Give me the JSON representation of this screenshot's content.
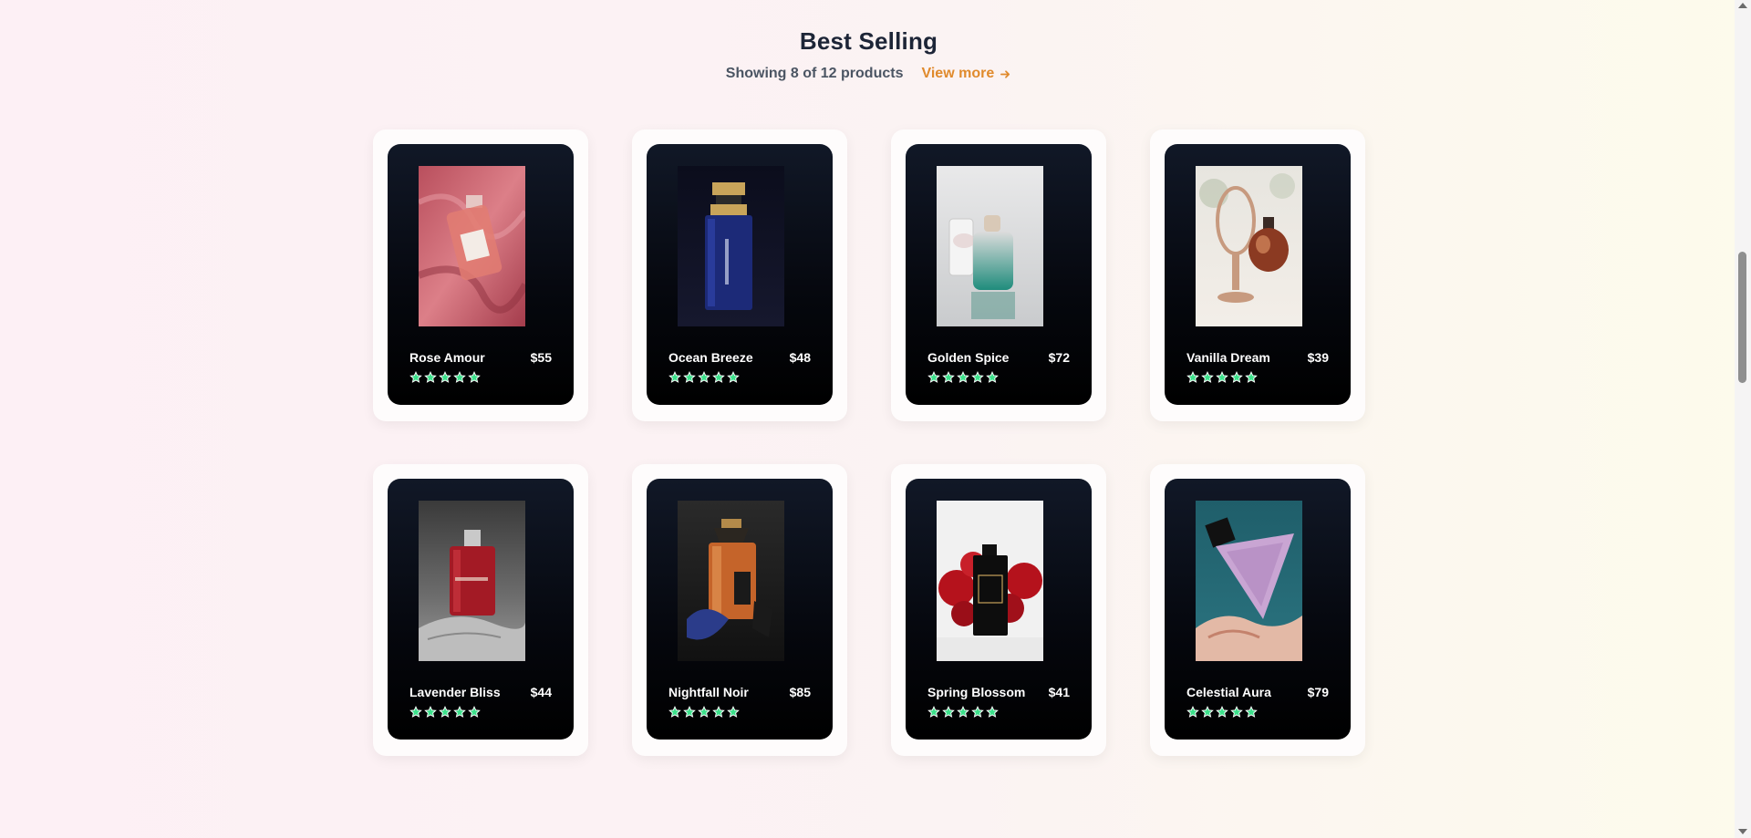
{
  "section": {
    "title": "Best Selling",
    "count_text": "Showing 8 of 12 products",
    "view_more": "View more"
  },
  "colors": {
    "accent": "#e08a2c",
    "star": "#3be08a",
    "title": "#1d2537"
  },
  "products": [
    {
      "name": "Rose Amour",
      "price": "$55",
      "rating": 5
    },
    {
      "name": "Ocean Breeze",
      "price": "$48",
      "rating": 5
    },
    {
      "name": "Golden Spice",
      "price": "$72",
      "rating": 5
    },
    {
      "name": "Vanilla Dream",
      "price": "$39",
      "rating": 5
    },
    {
      "name": "Lavender Bliss",
      "price": "$44",
      "rating": 5
    },
    {
      "name": "Nightfall Noir",
      "price": "$85",
      "rating": 5
    },
    {
      "name": "Spring Blossom",
      "price": "$41",
      "rating": 5
    },
    {
      "name": "Celestial Aura",
      "price": "$79",
      "rating": 5
    }
  ]
}
